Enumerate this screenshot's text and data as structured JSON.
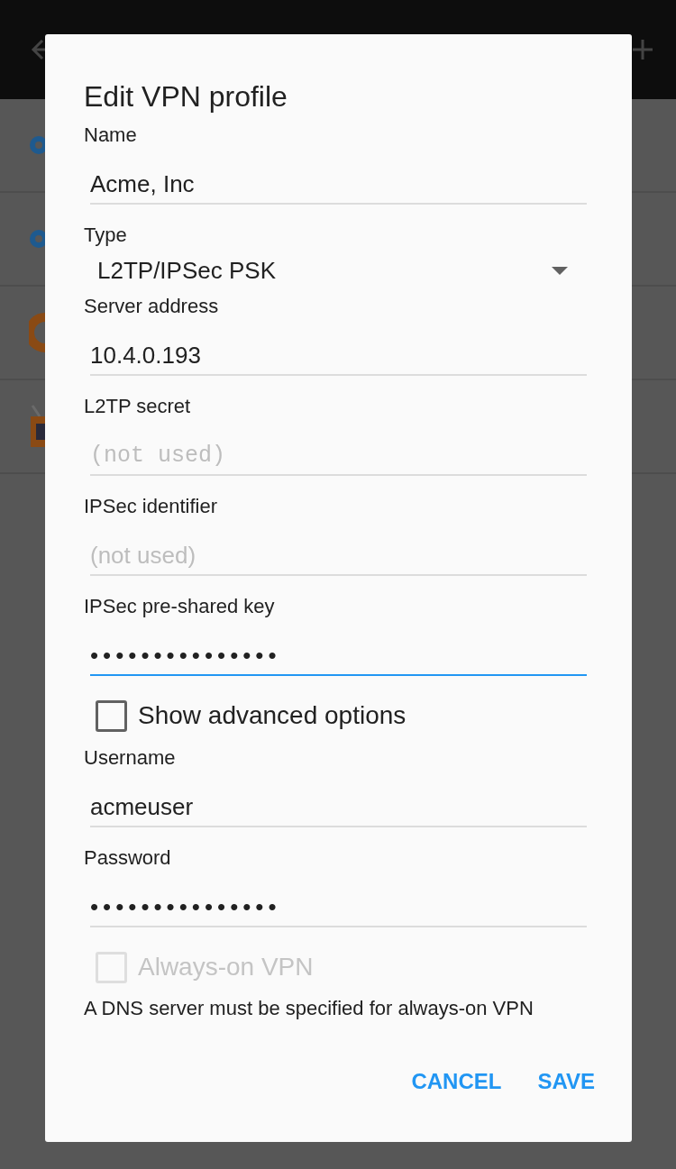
{
  "dialog": {
    "title": "Edit VPN profile",
    "fields": [
      {
        "kind": "text",
        "label": "Name",
        "value": "Acme, Inc",
        "focused": false
      },
      {
        "kind": "dropdown",
        "label": "Type",
        "value": "L2TP/IPSec PSK"
      },
      {
        "kind": "text",
        "label": "Server address",
        "value": "10.4.0.193",
        "focused": false
      },
      {
        "kind": "mono",
        "label": "L2TP secret",
        "placeholder": "(not used)",
        "focused": false
      },
      {
        "kind": "text",
        "label": "IPSec identifier",
        "placeholder": "(not used)",
        "focused": false
      },
      {
        "kind": "password",
        "label": "IPSec pre-shared key",
        "value": "•••••••••••••••",
        "focused": true
      },
      {
        "kind": "checkbox",
        "label": "Show advanced options",
        "checked": false,
        "disabled": false
      },
      {
        "kind": "text",
        "label": "Username",
        "value": "acmeuser",
        "focused": false
      },
      {
        "kind": "password",
        "label": "Password",
        "value": "•••••••••••••••",
        "focused": false
      },
      {
        "kind": "checkbox",
        "label": "Always-on VPN",
        "checked": false,
        "disabled": true
      },
      {
        "kind": "note",
        "text": "A DNS server must be specified for always-on VPN"
      }
    ],
    "buttons": [
      "CANCEL",
      "SAVE"
    ]
  }
}
